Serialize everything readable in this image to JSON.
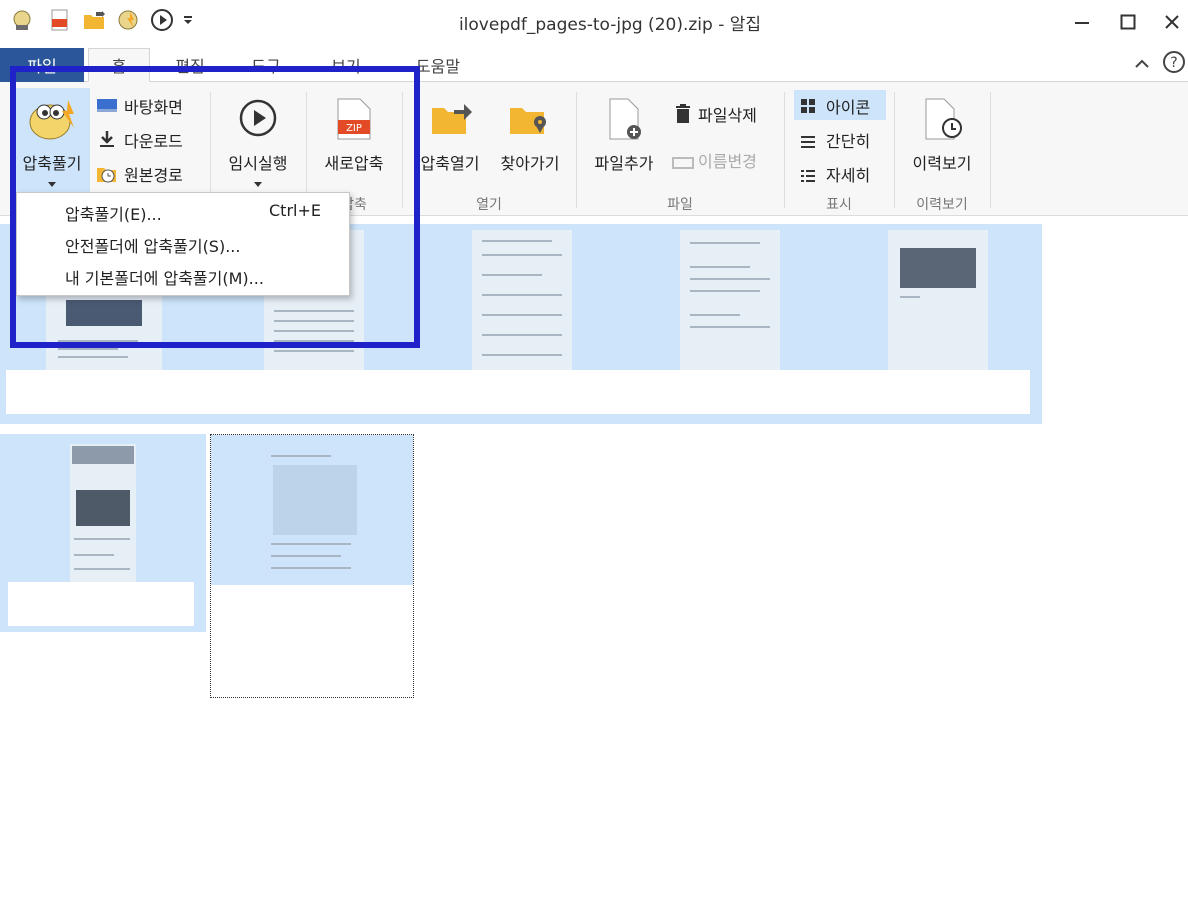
{
  "window": {
    "title": "ilovepdf_pages-to-jpg (20).zip - 알집",
    "minimize_icon": "minimize-icon",
    "maximize_icon": "maximize-icon",
    "close_icon": "close-icon"
  },
  "quick_access": {
    "icons": [
      "alzip-logo-icon",
      "zip-file-icon",
      "open-folder-icon",
      "extract-icon",
      "play-icon",
      "customize-dropdown-icon"
    ]
  },
  "tabs": {
    "file": "파일",
    "home": "홈",
    "edit": "편집",
    "tools": "도구",
    "view": "보기",
    "help": "도움말"
  },
  "ribbon": {
    "extract": "압축풀기",
    "desktop": "바탕화면",
    "download": "다운로드",
    "original_path": "원본경로",
    "temp_run": "임시실행",
    "new_compress": "새로압축",
    "compress_group": "압축",
    "open_compressed": "압축열기",
    "find": "찾아가기",
    "open_group": "열기",
    "add_file": "파일추가",
    "delete_file": "파일삭제",
    "rename": "이름변경",
    "file_group": "파일",
    "icon_view": "아이콘",
    "simple_view": "간단히",
    "detail_view": "자세히",
    "display_group": "표시",
    "history": "이력보기",
    "history_group": "이력보기"
  },
  "dropdown": {
    "items": [
      {
        "label": "압축풀기(E)...",
        "shortcut": "Ctrl+E"
      },
      {
        "label": "안전폴더에 압축풀기(S)...",
        "shortcut": ""
      },
      {
        "label": "내 기본폴더에 압축풀기(M)...",
        "shortcut": ""
      }
    ]
  },
  "colors": {
    "file_tab": "#2b579a",
    "highlight_border": "#1f22c8",
    "selection": "#cde4fa"
  }
}
